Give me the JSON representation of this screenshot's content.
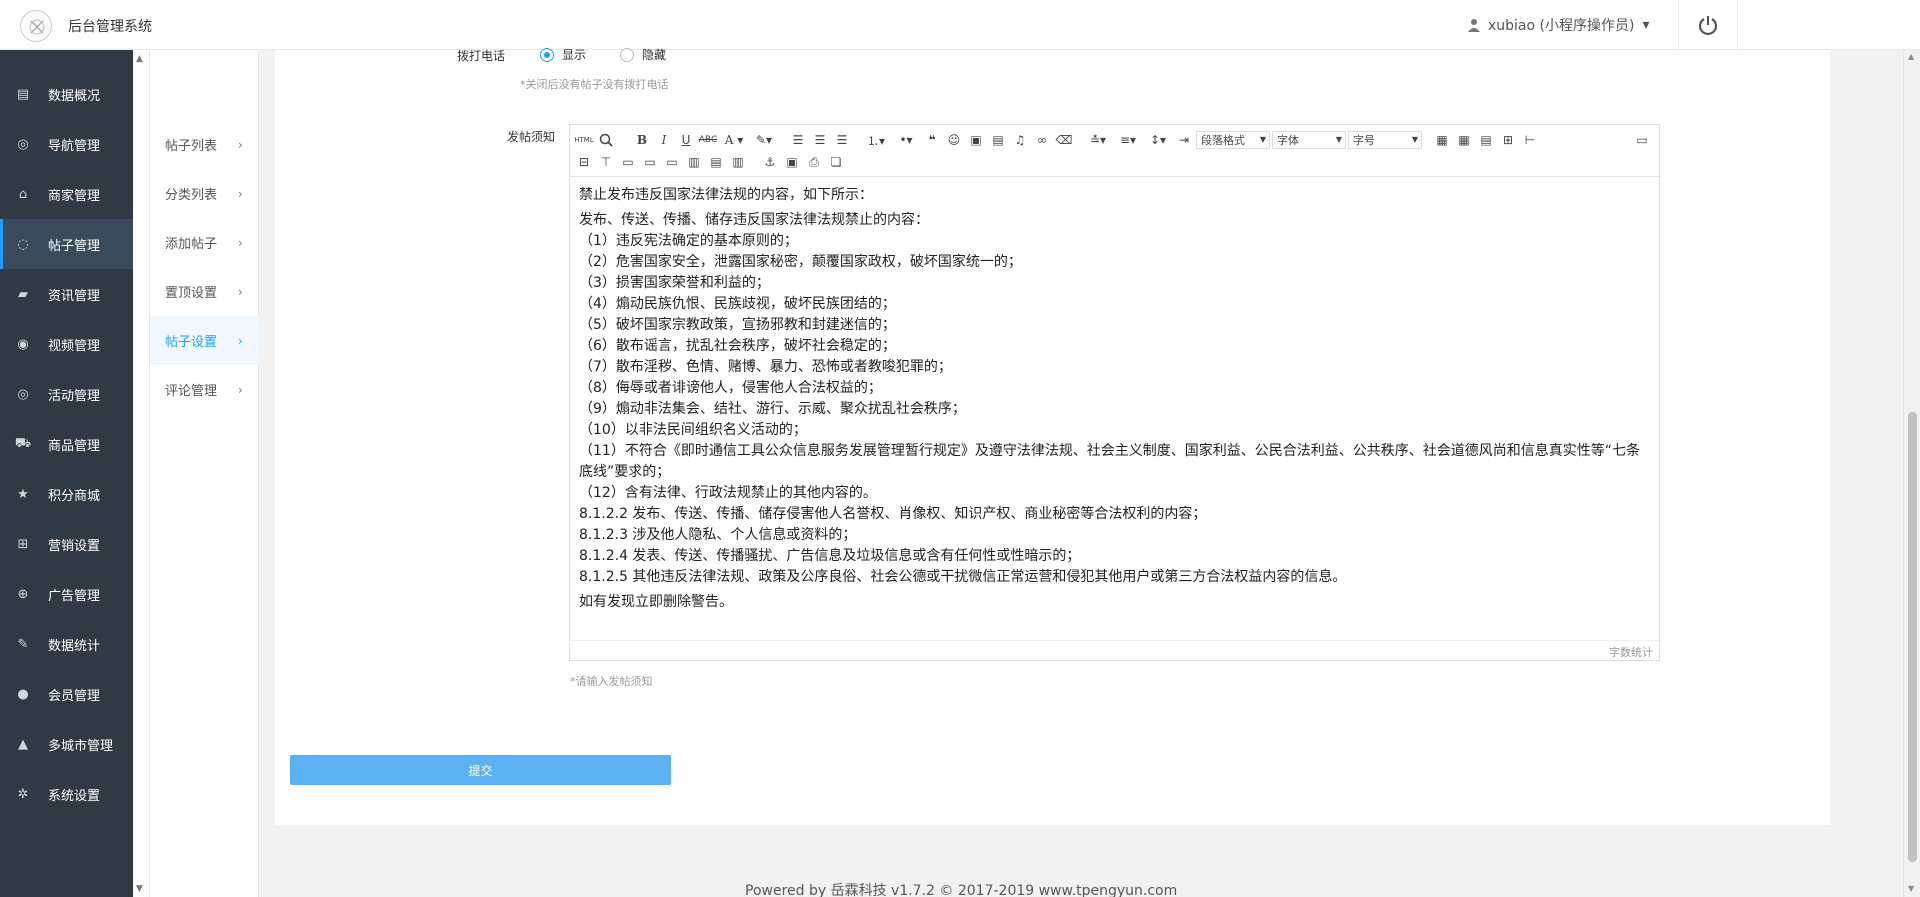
{
  "header": {
    "app_title": "后台管理系统",
    "user_label": "xubiao (小程序操作员)",
    "user_caret": "▾"
  },
  "sidebar": {
    "items": [
      {
        "label": "数据概况",
        "icon": "dashboard-icon"
      },
      {
        "label": "导航管理",
        "icon": "compass-icon"
      },
      {
        "label": "商家管理",
        "icon": "bank-icon"
      },
      {
        "label": "帖子管理",
        "icon": "chat-bubble-icon"
      },
      {
        "label": "资讯管理",
        "icon": "book-icon"
      },
      {
        "label": "视频管理",
        "icon": "play-circle-icon"
      },
      {
        "label": "活动管理",
        "icon": "target-icon"
      },
      {
        "label": "商品管理",
        "icon": "cart-icon"
      },
      {
        "label": "积分商城",
        "icon": "star-icon"
      },
      {
        "label": "营销设置",
        "icon": "gift-icon"
      },
      {
        "label": "广告管理",
        "icon": "lifebuoy-icon"
      },
      {
        "label": "数据统计",
        "icon": "wrench-icon"
      },
      {
        "label": "会员管理",
        "icon": "user-icon"
      },
      {
        "label": "多城市管理",
        "icon": "graduation-cap-icon"
      },
      {
        "label": "系统设置",
        "icon": "gear-icon"
      }
    ],
    "active_index": 3
  },
  "subnav": {
    "items": [
      {
        "label": "帖子列表"
      },
      {
        "label": "分类列表"
      },
      {
        "label": "添加帖子"
      },
      {
        "label": "置顶设置"
      },
      {
        "label": "帖子设置"
      },
      {
        "label": "评论管理"
      }
    ],
    "active_index": 4,
    "arrow": "›"
  },
  "form": {
    "phone_label": "拨打电话",
    "phone_options": [
      "显示",
      "隐藏"
    ],
    "phone_selected": "显示",
    "phone_hint": "*关闭后没有帖子没有拨打电话",
    "notice_label": "发帖须知",
    "notice_hint": "*请输入发帖须知",
    "submit_label": "提交"
  },
  "editor": {
    "toolbar": {
      "paragraph_format": "段落格式",
      "font_family": "字体",
      "font_size": "字号",
      "html_label": "HTML"
    },
    "content": [
      "禁止发布违反国家法律法规的内容，如下所示：",
      "发布、传送、传播、储存违反国家法律法规禁止的内容：",
      "（1）违反宪法确定的基本原则的；",
      "（2）危害国家安全，泄露国家秘密，颠覆国家政权，破坏国家统一的；",
      "（3）损害国家荣誉和利益的；",
      "（4）煽动民族仇恨、民族歧视，破坏民族团结的；",
      "（5）破坏国家宗教政策，宣扬邪教和封建迷信的；",
      "（6）散布谣言，扰乱社会秩序，破坏社会稳定的；",
      "（7）散布淫秽、色情、赌博、暴力、恐怖或者教唆犯罪的；",
      "（8）侮辱或者诽谤他人，侵害他人合法权益的；",
      "（9）煽动非法集会、结社、游行、示威、聚众扰乱社会秩序；",
      "（10）以非法民间组织名义活动的；",
      "（11）不符合《即时通信工具公众信息服务发展管理暂行规定》及遵守法律法规、社会主义制度、国家利益、公民合法利益、公共秩序、社会道德风尚和信息真实性等“七条底线”要求的；",
      "（12）含有法律、行政法规禁止的其他内容的。",
      "8.1.2.2 发布、传送、传播、储存侵害他人名誉权、肖像权、知识产权、商业秘密等合法权利的内容；",
      "8.1.2.3 涉及他人隐私、个人信息或资料的；",
      "8.1.2.4 发表、传送、传播骚扰、广告信息及垃圾信息或含有任何性或性暗示的；",
      "8.1.2.5 其他违反法律法规、政策及公序良俗、社会公德或干扰微信正常运营和侵犯其他用户或第三方合法权益内容的信息。",
      "如有发现立即删除警告。"
    ],
    "char_count_label": "字数统计"
  },
  "footer": {
    "text": "Powered by 岳霖科技 v1.7.2 © 2017-2019 www.tpengyun.com"
  },
  "colors": {
    "sidebar_bg": "#2f3a45",
    "accent": "#1e9fff",
    "submit_bg": "#5ab1f3"
  }
}
